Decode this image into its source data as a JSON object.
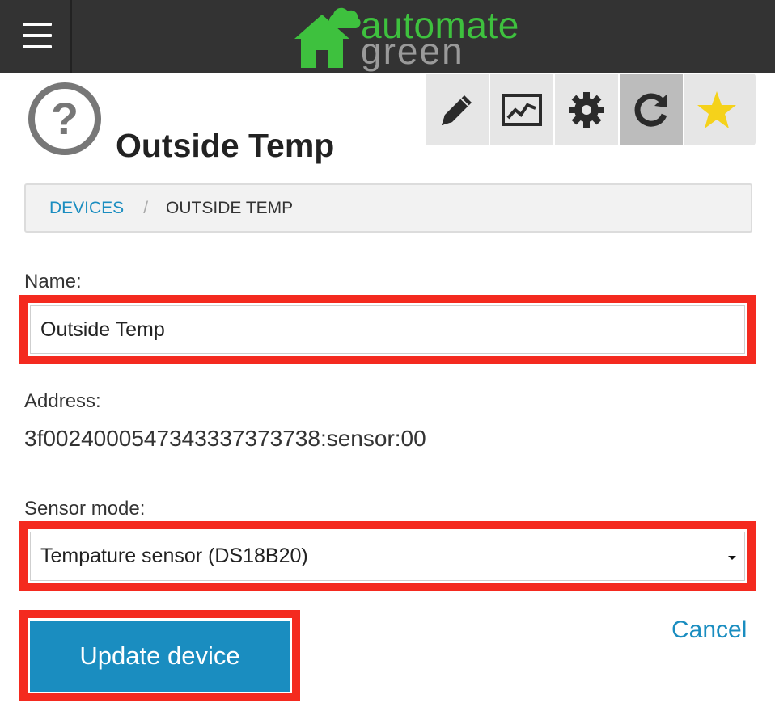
{
  "header": {
    "menu_icon": "hamburger-icon",
    "logo": {
      "word1": "automate",
      "word2": "green",
      "colors": {
        "green": "#3ec13e",
        "gray": "#9a9a9a"
      }
    }
  },
  "device": {
    "status_icon": "question-circle-icon",
    "title": "Outside Temp"
  },
  "toolbar": {
    "buttons": [
      {
        "icon": "pencil-icon",
        "active": false
      },
      {
        "icon": "chart-icon",
        "active": false
      },
      {
        "icon": "gear-icon",
        "active": false
      },
      {
        "icon": "refresh-icon",
        "active": true
      },
      {
        "icon": "star-icon",
        "active": false
      }
    ]
  },
  "breadcrumb": {
    "link": "DEVICES",
    "separator": "/",
    "current": "OUTSIDE TEMP"
  },
  "form": {
    "name_label": "Name:",
    "name_value": "Outside Temp",
    "address_label": "Address:",
    "address_value": "3f0024000547343337373738:sensor:00",
    "sensor_mode_label": "Sensor mode:",
    "sensor_mode_value": "Tempature sensor (DS18B20)",
    "update_label": "Update device",
    "cancel_label": "Cancel"
  },
  "colors": {
    "topbar": "#333333",
    "accent": "#1a8dc0",
    "highlight": "#f42a1f",
    "star": "#f5d21b"
  }
}
